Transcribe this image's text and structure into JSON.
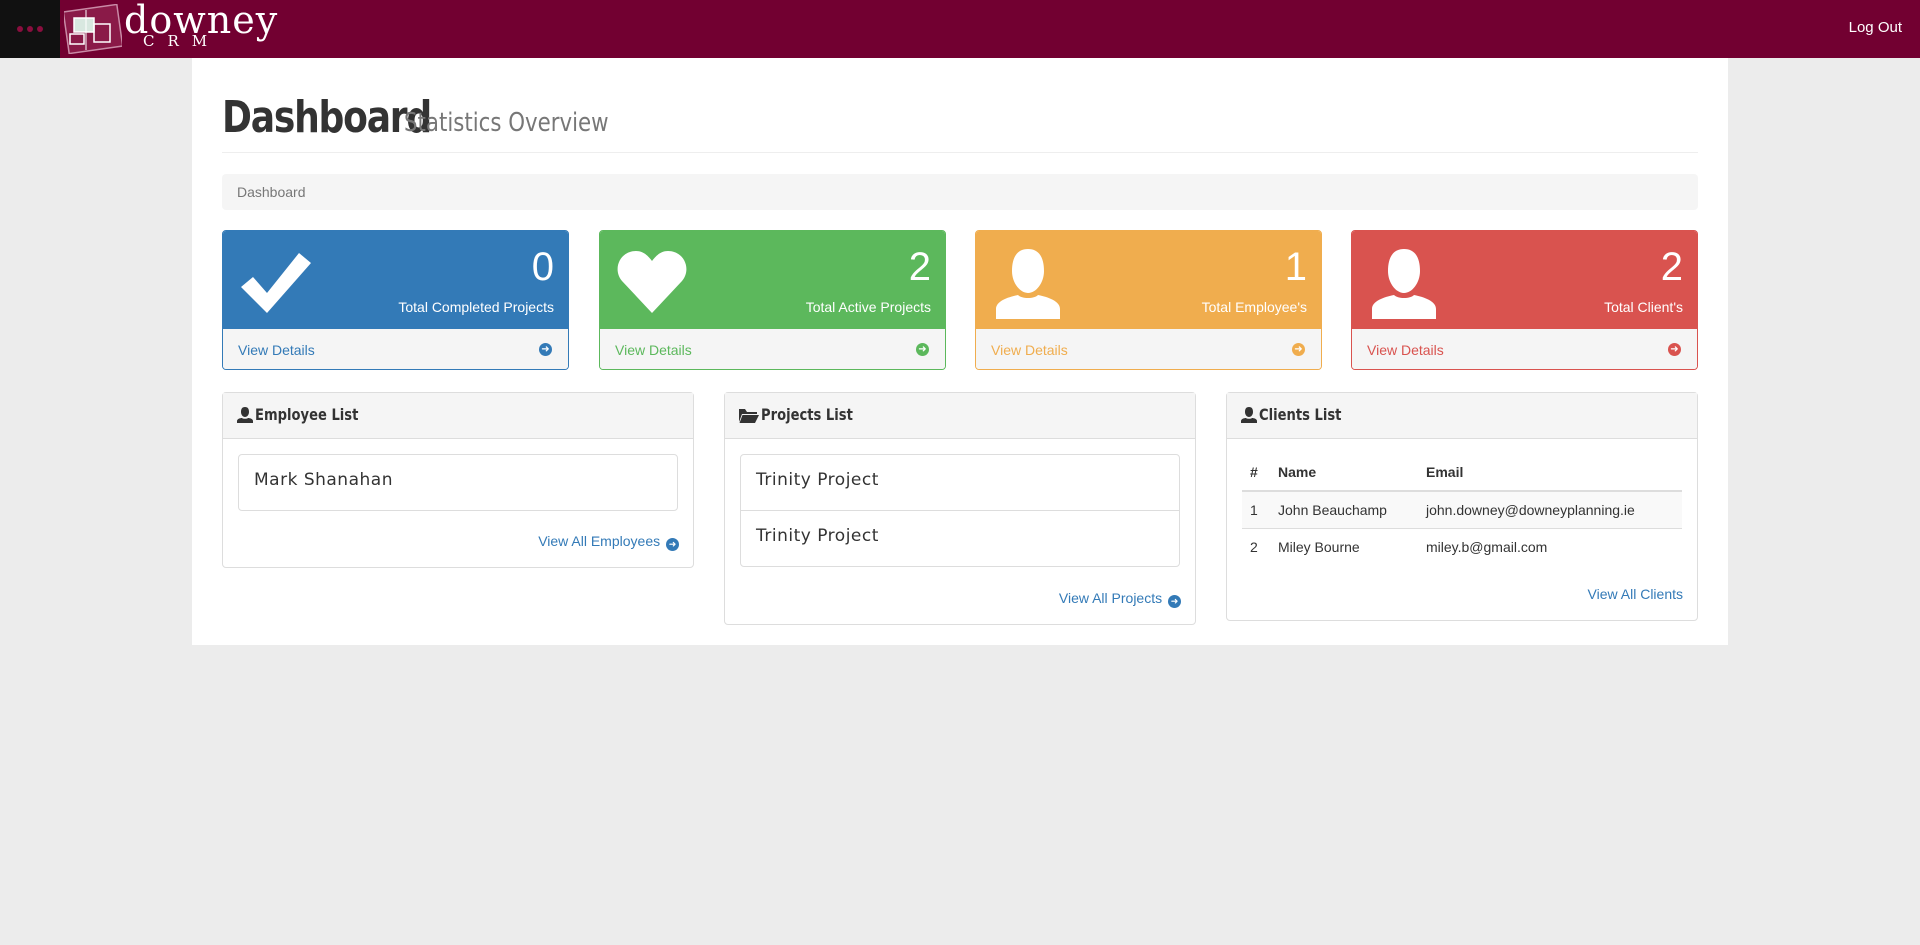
{
  "topbar": {
    "brand_name": "downey",
    "brand_sub": "CRM",
    "logout_label": "Log Out",
    "bar_color": "#720031"
  },
  "header": {
    "title": "Dashboard",
    "subtitle": "Statistics Overview"
  },
  "breadcrumb": {
    "current": "Dashboard"
  },
  "stats": [
    {
      "value": "0",
      "label": "Total Completed Projects",
      "link": "View Details",
      "icon": "check-icon",
      "color": "#337ab7"
    },
    {
      "value": "2",
      "label": "Total Active Projects",
      "link": "View Details",
      "icon": "heart-icon",
      "color": "#5cb85c"
    },
    {
      "value": "1",
      "label": "Total Employee's",
      "link": "View Details",
      "icon": "user-icon",
      "color": "#f0ad4e"
    },
    {
      "value": "2",
      "label": "Total Client's",
      "link": "View Details",
      "icon": "user-icon",
      "color": "#d9534f"
    }
  ],
  "employees": {
    "title": "Employee List",
    "items": [
      "Mark Shanahan"
    ],
    "view_all": "View All Employees"
  },
  "projects": {
    "title": "Projects List",
    "items": [
      "Trinity Project",
      "Trinity Project"
    ],
    "view_all": "View All Projects"
  },
  "clients": {
    "title": "Clients List",
    "columns": [
      "#",
      "Name",
      "Email"
    ],
    "rows": [
      [
        "1",
        "John Beauchamp",
        "john.downey@downeyplanning.ie"
      ],
      [
        "2",
        "Miley Bourne",
        "miley.b@gmail.com"
      ]
    ],
    "view_all": "View All Clients"
  }
}
